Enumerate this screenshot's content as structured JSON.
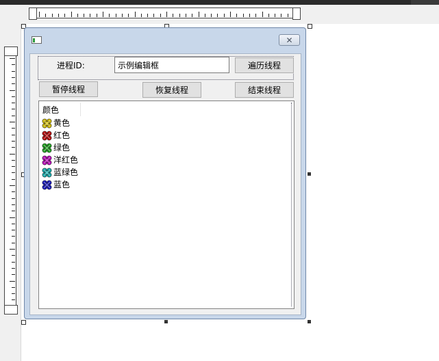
{
  "dialog": {
    "close_glyph": "✕",
    "process_id_label": "进程ID:",
    "process_id_edit_value": "示例编辑框",
    "buttons": {
      "enumerate_threads": "遍历线程",
      "suspend_thread": "暂停线程",
      "resume_thread": "恢复线程",
      "end_thread": "结束线程"
    },
    "list": {
      "column_header": "颜色",
      "items": [
        {
          "label": "黄色",
          "icon": "clover-icon",
          "color": "#c8b400"
        },
        {
          "label": "红色",
          "icon": "clover-icon",
          "color": "#b00000"
        },
        {
          "label": "绿色",
          "icon": "clover-icon",
          "color": "#1a9a1a"
        },
        {
          "label": "洋红色",
          "icon": "clover-icon",
          "color": "#b000b0"
        },
        {
          "label": "蓝绿色",
          "icon": "clover-icon",
          "color": "#12a4a4"
        },
        {
          "label": "蓝色",
          "icon": "clover-icon",
          "color": "#1212b4"
        }
      ]
    }
  }
}
